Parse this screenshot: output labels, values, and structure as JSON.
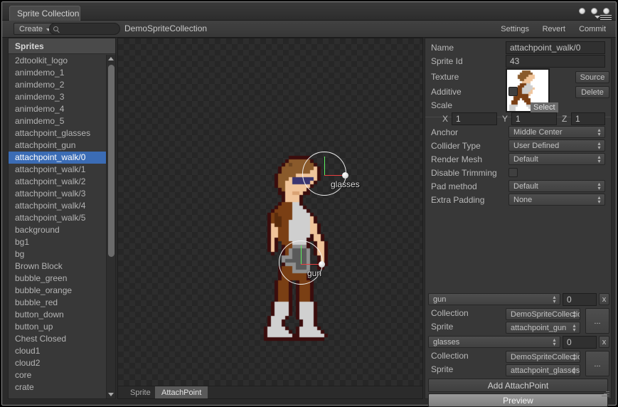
{
  "window": {
    "tab_title": "Sprite Collection"
  },
  "toolbar": {
    "create_label": "Create",
    "search_value": "",
    "search_placeholder": "",
    "collection_name": "DemoSpriteCollection",
    "settings_label": "Settings",
    "revert_label": "Revert",
    "commit_label": "Commit"
  },
  "sprite_list": {
    "header": "Sprites",
    "selected": "attachpoint_walk/0",
    "items": [
      "2dtoolkit_logo",
      "animdemo_1",
      "animdemo_2",
      "animdemo_3",
      "animdemo_4",
      "animdemo_5",
      "attachpoint_glasses",
      "attachpoint_gun",
      "attachpoint_walk/0",
      "attachpoint_walk/1",
      "attachpoint_walk/2",
      "attachpoint_walk/3",
      "attachpoint_walk/4",
      "attachpoint_walk/5",
      "background",
      "bg1",
      "bg",
      "Brown Block",
      "bubble_green",
      "bubble_orange",
      "bubble_red",
      "button_down",
      "button_up",
      "Chest Closed",
      "cloud1",
      "cloud2",
      "core",
      "crate"
    ]
  },
  "canvas": {
    "gizmos": [
      {
        "label": "glasses"
      },
      {
        "label": "gun"
      }
    ],
    "tabs": [
      {
        "label": "Sprite",
        "active": false
      },
      {
        "label": "AttachPoint",
        "active": true
      }
    ]
  },
  "inspector": {
    "name_label": "Name",
    "name_value": "attachpoint_walk/0",
    "sprite_id_label": "Sprite Id",
    "sprite_id_value": "43",
    "texture_label": "Texture",
    "texture_select_label": "Select",
    "source_label": "Source",
    "delete_label": "Delete",
    "additive_label": "Additive",
    "scale_label": "Scale",
    "scale_x_label": "X",
    "scale_x_value": "1",
    "scale_y_label": "Y",
    "scale_y_value": "1",
    "scale_z_label": "Z",
    "scale_z_value": "1",
    "anchor_label": "Anchor",
    "anchor_value": "Middle Center",
    "collider_type_label": "Collider Type",
    "collider_type_value": "User Defined",
    "render_mesh_label": "Render Mesh",
    "render_mesh_value": "Default",
    "disable_trimming_label": "Disable Trimming",
    "pad_method_label": "Pad method",
    "pad_method_value": "Default",
    "extra_padding_label": "Extra Padding",
    "extra_padding_value": "None",
    "attachpoints": [
      {
        "name": "gun",
        "angle": "0",
        "remove_label": "x",
        "collection_label": "Collection",
        "collection_value": "DemoSpriteCollection",
        "sprite_label": "Sprite",
        "sprite_value": "attachpoint_gun",
        "more_label": "..."
      },
      {
        "name": "glasses",
        "angle": "0",
        "remove_label": "x",
        "collection_label": "Collection",
        "collection_value": "DemoSpriteCollection",
        "sprite_label": "Sprite",
        "sprite_value": "attachpoint_glasses",
        "more_label": "..."
      }
    ],
    "add_attachpoint_label": "Add AttachPoint",
    "preview_label": "Preview"
  },
  "colors": {
    "selection_blue": "#3b6cb5",
    "axis_green": "#5ef05e",
    "axis_red": "#e84040",
    "panel_bg": "#383838"
  }
}
